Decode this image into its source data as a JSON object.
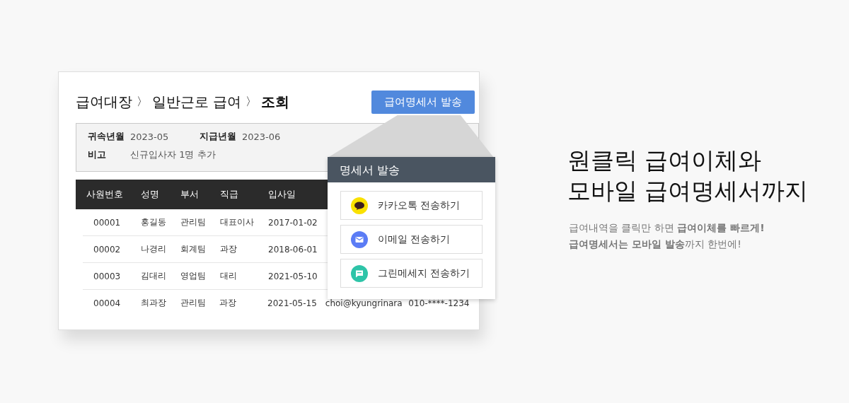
{
  "card": {
    "breadcrumb": [
      {
        "label": "급여대장",
        "current": false
      },
      {
        "label": "일반근로 급여",
        "current": false
      },
      {
        "label": "조회",
        "current": true
      }
    ],
    "separator": "〉",
    "send_button": "급여명세서 발송",
    "info": [
      {
        "label": "귀속년월",
        "value": "2023-05"
      },
      {
        "label": "지급년월",
        "value": "2023-06"
      },
      {
        "label": "비고",
        "value": "신규입사자 1명 추가"
      }
    ],
    "table": {
      "columns": [
        "사원번호",
        "성명",
        "부서",
        "직급",
        "입사일"
      ],
      "rows": [
        [
          "00001",
          "홍길동",
          "관리팀",
          "대표이사",
          "2017-01-02"
        ],
        [
          "00002",
          "나경리",
          "회계팀",
          "과장",
          "2018-06-01"
        ],
        [
          "00003",
          "김대리",
          "영업팀",
          "대리",
          "2021-05-10"
        ],
        [
          "00004",
          "최과장",
          "관리팀",
          "과장",
          "2021-05-15",
          "choi@kyungrinara",
          "010-****-1234"
        ]
      ]
    }
  },
  "popup": {
    "title": "명세서 발송",
    "options": [
      {
        "kind": "kakao",
        "label": "카카오톡 전송하기",
        "color": "#fae100"
      },
      {
        "kind": "email",
        "label": "이메일 전송하기",
        "color": "#5b7cf5"
      },
      {
        "kind": "message",
        "label": "그린메세지 전송하기",
        "color": "#2ec4a8"
      }
    ]
  },
  "headline": [
    "원클릭 급여이체와",
    "모바일 급여명세서까지"
  ],
  "description": [
    "급여내역을 클릭만 하면 **급여이체를 빠르게!**",
    "**급여명세서는 모바일 발송**까지 한번에!"
  ]
}
